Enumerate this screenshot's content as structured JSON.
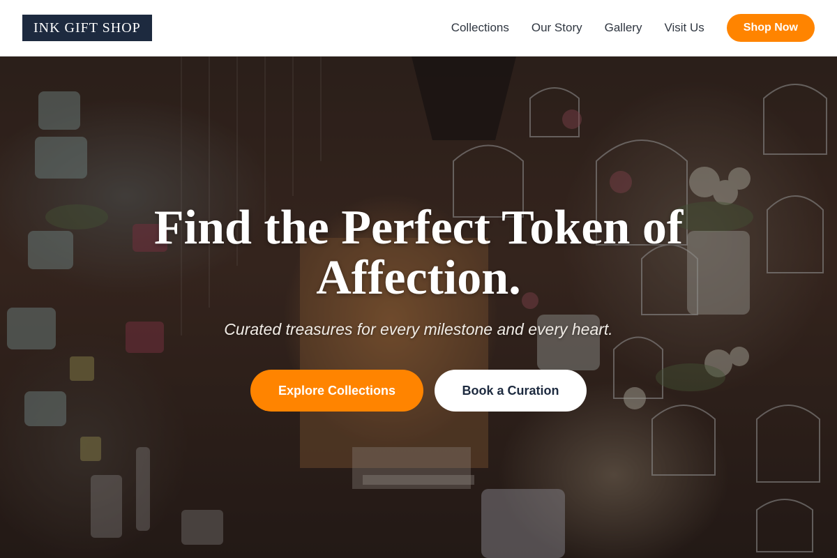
{
  "header": {
    "logo_text": "INK GIFT SHOP",
    "nav": [
      "Collections",
      "Our Story",
      "Gallery",
      "Visit Us"
    ],
    "cta_label": "Shop Now"
  },
  "hero": {
    "title": "Find the Perfect Token of Affection.",
    "subtitle": "Curated treasures for every milestone and every heart.",
    "primary_button": "Explore Collections",
    "secondary_button": "Book a Curation",
    "background_image": "shop interior with hanging white birdcages, teacups, watering cans and flowers"
  },
  "colors": {
    "accent": "#ff8400",
    "logo_bg": "#1d2a3f",
    "header_bg": "#ffffff"
  }
}
